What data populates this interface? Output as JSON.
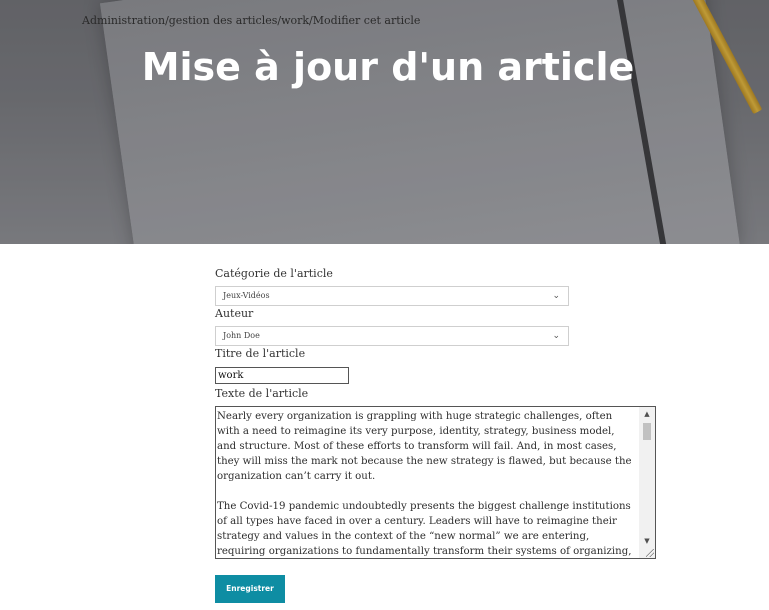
{
  "breadcrumb": "Administration/gestion des articles/work/Modifier cet article",
  "page_title": "Mise à jour d'un article",
  "form": {
    "category": {
      "label": "Catégorie de l'article",
      "selected": "Jeux-Vidéos"
    },
    "author": {
      "label": "Auteur",
      "selected": "John Doe"
    },
    "title": {
      "label": "Titre de l'article",
      "value": "work"
    },
    "text": {
      "label": "Texte de l'article",
      "value": "Nearly every organization is grappling with huge strategic challenges, often with a need to reimagine its very purpose, identity, strategy, business model, and structure. Most of these efforts to transform will fail. And, in most cases, they will miss the mark not because the new strategy is flawed, but because the organization can’t carry it out.\n\nThe Covid-19 pandemic undoubtedly presents the biggest challenge institutions of all types have faced in over a century. Leaders will have to reimagine their strategy and values in the context of the “new normal” we are entering, requiring organizations to fundamentally transform their systems of organizing, managing, and leading to enable effective execution of the new direction — and do it quickly. In this crisis speed is"
    },
    "save_label": "Enregistrer"
  },
  "colors": {
    "accent": "#0e8da3"
  },
  "icons": {
    "select_chevron": "chevron-down-icon",
    "scroll_up": "arrow-up-icon",
    "scroll_down": "arrow-down-icon"
  }
}
